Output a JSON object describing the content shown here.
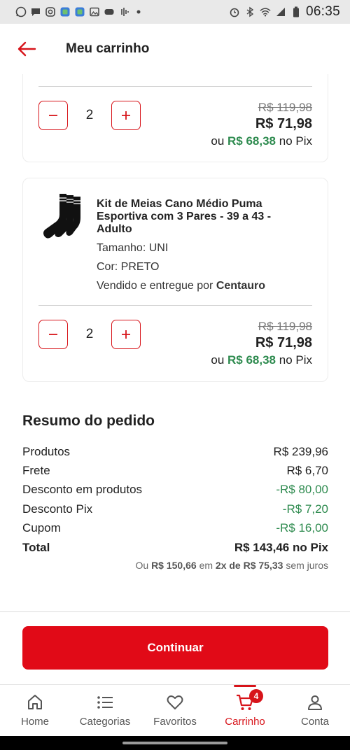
{
  "status_bar": {
    "time": "06:35",
    "left_icons": [
      "whatsapp-icon",
      "chat-icon",
      "instagram-icon",
      "app-icon",
      "app-icon",
      "image-icon",
      "game-icon",
      "audio-icon",
      "dot-icon"
    ],
    "right_icons": [
      "alarm-icon",
      "bluetooth-icon",
      "wifi-icon",
      "signal-icon",
      "battery-icon"
    ]
  },
  "header": {
    "title": "Meu carrinho"
  },
  "cart_items": [
    {
      "quantity": "2",
      "old_price": "R$ 119,98",
      "new_price": "R$ 71,98",
      "pix_prefix": "ou",
      "pix_price": "R$ 68,38",
      "pix_suffix": "no Pix"
    },
    {
      "name": "Kit de Meias Cano Médio Puma Esportiva com 3 Pares - 39 a 43 - Adulto",
      "size": "Tamanho: UNI",
      "color": "Cor: PRETO",
      "seller_prefix": "Vendido e entregue por",
      "seller": "Centauro",
      "quantity": "2",
      "old_price": "R$ 119,98",
      "new_price": "R$ 71,98",
      "pix_prefix": "ou",
      "pix_price": "R$ 68,38",
      "pix_suffix": "no Pix"
    }
  ],
  "summary": {
    "title": "Resumo do pedido",
    "rows": [
      {
        "label": "Produtos",
        "value": "R$ 239,96"
      },
      {
        "label": "Frete",
        "value": "R$ 6,70"
      },
      {
        "label": "Desconto em produtos",
        "value": "-R$ 80,00"
      },
      {
        "label": "Desconto Pix",
        "value": "-R$ 7,20"
      },
      {
        "label": "Cupom",
        "value": "-R$ 16,00"
      }
    ],
    "total_label": "Total",
    "total_value": "R$ 143,46 no Pix",
    "installment": {
      "prefix": "Ou",
      "amount": "R$ 150,66",
      "mid": "em",
      "plan": "2x de R$ 75,33",
      "suffix": "sem juros"
    }
  },
  "continue_label": "Continuar",
  "tabs": [
    {
      "label": "Home",
      "icon": "home-icon"
    },
    {
      "label": "Categorias",
      "icon": "list-icon"
    },
    {
      "label": "Favoritos",
      "icon": "heart-icon"
    },
    {
      "label": "Carrinho",
      "icon": "cart-icon",
      "badge": "4",
      "active": true
    },
    {
      "label": "Conta",
      "icon": "user-icon"
    }
  ],
  "colors": {
    "brand_red": "#e10a17",
    "pix_green": "#2e8b4f"
  }
}
